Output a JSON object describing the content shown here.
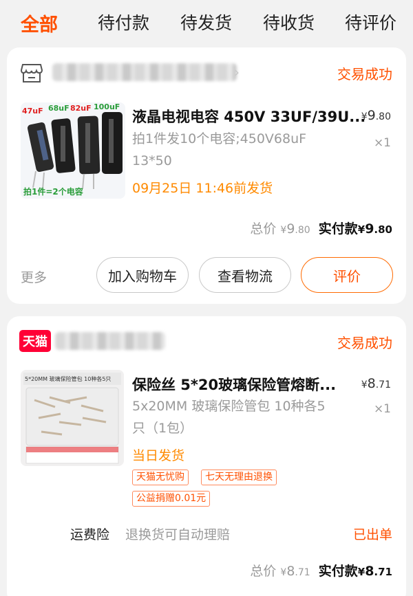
{
  "tabs": [
    "全部",
    "待付款",
    "待发货",
    "待收货",
    "待评价"
  ],
  "orders": [
    {
      "status": "交易成功",
      "title": "液晶电视电容 450V 33UF/39U...",
      "spec_line1": "拍1件发10个电容;450V68uF",
      "spec_line2": "13*50",
      "shipping": "09月25日 11:46前发货",
      "price_int": "9",
      "price_dec": ".80",
      "qty": "×1",
      "currency": "¥",
      "total_label": "总价",
      "total_int": "9",
      "total_dec": ".80",
      "paid_label": "实付款",
      "paid_int": "9",
      "paid_dec": ".80",
      "image_labels": [
        "47uF",
        "68uF",
        "82uF",
        "100uF",
        "拍1件=2个电容"
      ],
      "more": "更多",
      "buttons": [
        "加入购物车",
        "查看物流",
        "评价"
      ]
    },
    {
      "shop_badge": "天猫",
      "status": "交易成功",
      "title": "保险丝 5*20玻璃保险管熔断...",
      "spec_line1": "5x20MM 玻璃保险管包 10种各5",
      "spec_line2": "只（1包）",
      "shipping": "当日发货",
      "tags": [
        "天猫无忧购",
        "七天无理由退换",
        "公益捐赠0.01元"
      ],
      "price_int": "8",
      "price_dec": ".71",
      "qty": "×1",
      "currency": "¥",
      "image_labels": [
        "5*20MM 玻璃保险管包 10种各5只"
      ],
      "service_label": "运费险",
      "service_desc": "退换货可自动理赔",
      "service_status": "已出单",
      "total_label": "总价",
      "total_int": "8",
      "total_dec": ".71",
      "paid_label": "实付款",
      "paid_int": "8",
      "paid_dec": ".71"
    }
  ],
  "colors": {
    "accent": "#ff5000",
    "shipping": "#ff8a00",
    "tmall": "#ff0036"
  }
}
